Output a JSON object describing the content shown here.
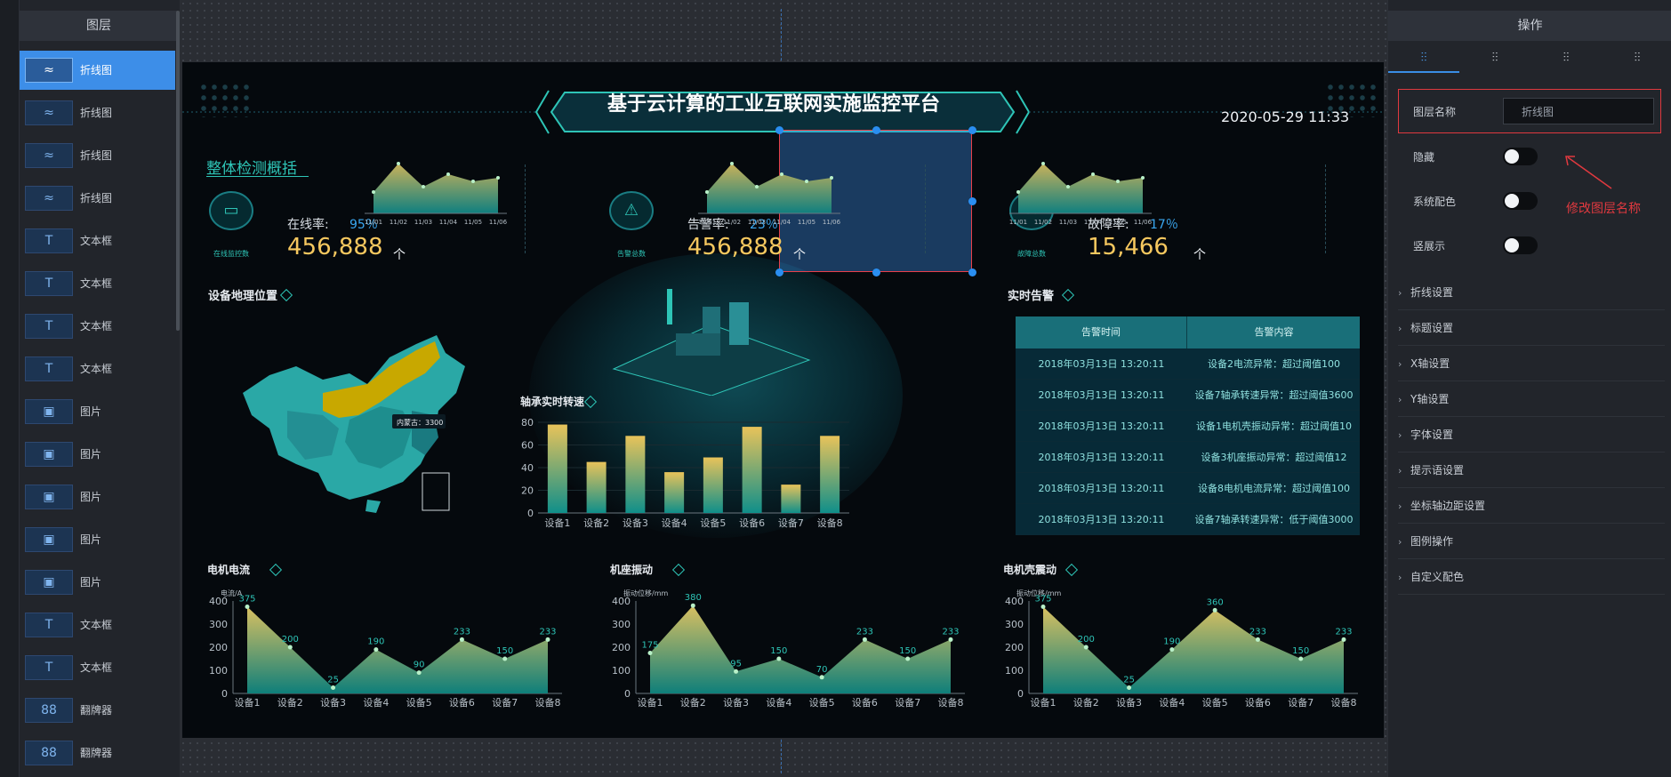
{
  "layers_panel": {
    "title": "图层",
    "items": [
      {
        "label": "折线图",
        "icon": "line-chart-icon",
        "glyph": "≈",
        "active": true
      },
      {
        "label": "折线图",
        "icon": "line-chart-icon",
        "glyph": "≈"
      },
      {
        "label": "折线图",
        "icon": "line-chart-icon",
        "glyph": "≈"
      },
      {
        "label": "折线图",
        "icon": "line-chart-icon",
        "glyph": "≈"
      },
      {
        "label": "文本框",
        "icon": "text-icon",
        "glyph": "T"
      },
      {
        "label": "文本框",
        "icon": "text-icon",
        "glyph": "T"
      },
      {
        "label": "文本框",
        "icon": "text-icon",
        "glyph": "T"
      },
      {
        "label": "文本框",
        "icon": "text-icon",
        "glyph": "T"
      },
      {
        "label": "图片",
        "icon": "image-icon",
        "glyph": "▣"
      },
      {
        "label": "图片",
        "icon": "image-icon",
        "glyph": "▣"
      },
      {
        "label": "图片",
        "icon": "image-icon",
        "glyph": "▣"
      },
      {
        "label": "图片",
        "icon": "image-icon",
        "glyph": "▣"
      },
      {
        "label": "图片",
        "icon": "image-icon",
        "glyph": "▣"
      },
      {
        "label": "文本框",
        "icon": "text-icon",
        "glyph": "T"
      },
      {
        "label": "文本框",
        "icon": "text-icon",
        "glyph": "T"
      },
      {
        "label": "翻牌器",
        "icon": "flip-counter-icon",
        "glyph": "88"
      },
      {
        "label": "翻牌器",
        "icon": "flip-counter-icon",
        "glyph": "88"
      }
    ]
  },
  "ops_panel": {
    "title": "操作",
    "tabs": [
      {
        "glyph": "⫶⫶"
      },
      {
        "glyph": "⫶⫶"
      },
      {
        "glyph": "⫶⫶"
      },
      {
        "glyph": "⫶⫶"
      }
    ],
    "layer_name_label": "图层名称",
    "layer_name_value": "折线图",
    "toggles": [
      {
        "label": "隐藏",
        "on": false
      },
      {
        "label": "系统配色",
        "on": false
      },
      {
        "label": "竖展示",
        "on": false
      }
    ],
    "annotation": "修改图层名称",
    "sections": [
      "折线设置",
      "标题设置",
      "X轴设置",
      "Y轴设置",
      "字体设置",
      "提示语设置",
      "坐标轴边距设置",
      "图例操作",
      "自定义配色"
    ]
  },
  "dashboard": {
    "title": "基于云计算的工业互联网实施监控平台",
    "datetime": "2020-05-29 11:33",
    "overview_title": "整体检测概括",
    "kpis": [
      {
        "caption": "在线监控数",
        "rate_label": "在线率:",
        "rate": "95％",
        "value": "456,888",
        "unit": "个",
        "icon": "monitor-icon"
      },
      {
        "caption": "告警总数",
        "rate_label": "告警率:",
        "rate": "23％",
        "value": "456,888",
        "unit": "个",
        "icon": "alarm-icon"
      },
      {
        "caption": "故障总数",
        "rate_label": "故障率:",
        "rate": "17％",
        "value": "15,466",
        "unit": "个",
        "icon": "tools-icon"
      }
    ],
    "map": {
      "title": "设备地理位置",
      "tooltip": "内蒙古：3300"
    },
    "alerts": {
      "title": "实时告警",
      "headers": [
        "告警时间",
        "告警内容"
      ],
      "rows": [
        [
          "2018年03月13日 13:20:11",
          "设备2电流异常：超过阈值100"
        ],
        [
          "2018年03月13日 13:20:11",
          "设备7轴承转速异常：超过阈值3600"
        ],
        [
          "2018年03月13日 13:20:11",
          "设备1电机壳振动异常：超过阈值10"
        ],
        [
          "2018年03月13日 13:20:11",
          "设备3机座振动异常：超过阈值12"
        ],
        [
          "2018年03月13日 13:20:11",
          "设备8电机电流异常：超过阈值100"
        ],
        [
          "2018年03月13日 13:20:11",
          "设备7轴承转速异常：低于阈值3000"
        ]
      ]
    },
    "colors": {
      "accent": "#2ec4b6",
      "gold": "#f6c85f",
      "map_highlight": "#c8a800",
      "selection": "#3d8ee8"
    }
  },
  "chart_data": [
    {
      "type": "area",
      "x": [
        "11/01",
        "11/02",
        "11/03",
        "11/04",
        "11/05",
        "11/06"
      ],
      "values": [
        12,
        28,
        15,
        22,
        18,
        20
      ],
      "ylim": [
        0,
        30
      ]
    },
    {
      "type": "area",
      "x": [
        "11/01",
        "11/02",
        "11/03",
        "11/04",
        "11/05",
        "11/06"
      ],
      "values": [
        12,
        28,
        15,
        22,
        18,
        20
      ],
      "ylim": [
        0,
        30
      ]
    },
    {
      "type": "area",
      "x": [
        "11/01",
        "11/02",
        "11/03",
        "11/04",
        "11/05",
        "11/06"
      ],
      "values": [
        12,
        28,
        15,
        22,
        18,
        20
      ],
      "ylim": [
        0,
        30
      ]
    },
    {
      "type": "bar",
      "title": "轴承实时转速",
      "categories": [
        "设备1",
        "设备2",
        "设备3",
        "设备4",
        "设备5",
        "设备6",
        "设备7",
        "设备8"
      ],
      "values": [
        78,
        45,
        68,
        36,
        49,
        76,
        25,
        68
      ],
      "ylim": [
        0,
        80
      ],
      "yticks": [
        0,
        20,
        40,
        60,
        80
      ]
    },
    {
      "type": "area",
      "title": "电机电流",
      "ylabel": "电流/A",
      "categories": [
        "设备1",
        "设备2",
        "设备3",
        "设备4",
        "设备5",
        "设备6",
        "设备7",
        "设备8"
      ],
      "values": [
        375,
        200,
        25,
        190,
        90,
        233,
        150,
        233
      ],
      "ylim": [
        0,
        400
      ],
      "yticks": [
        0,
        100,
        200,
        300,
        400
      ]
    },
    {
      "type": "area",
      "title": "机座振动",
      "ylabel": "振动位移/mm",
      "categories": [
        "设备1",
        "设备2",
        "设备3",
        "设备4",
        "设备5",
        "设备6",
        "设备7",
        "设备8"
      ],
      "values": [
        175,
        380,
        95,
        150,
        70,
        233,
        150,
        233
      ],
      "ylim": [
        0,
        400
      ],
      "yticks": [
        0,
        100,
        200,
        300,
        400
      ]
    },
    {
      "type": "area",
      "title": "电机壳震动",
      "ylabel": "振动位移/mm",
      "categories": [
        "设备1",
        "设备2",
        "设备3",
        "设备4",
        "设备5",
        "设备6",
        "设备7",
        "设备8"
      ],
      "values": [
        375,
        200,
        25,
        190,
        360,
        233,
        150,
        233
      ],
      "ylim": [
        0,
        400
      ],
      "yticks": [
        0,
        100,
        200,
        300,
        400
      ]
    }
  ]
}
